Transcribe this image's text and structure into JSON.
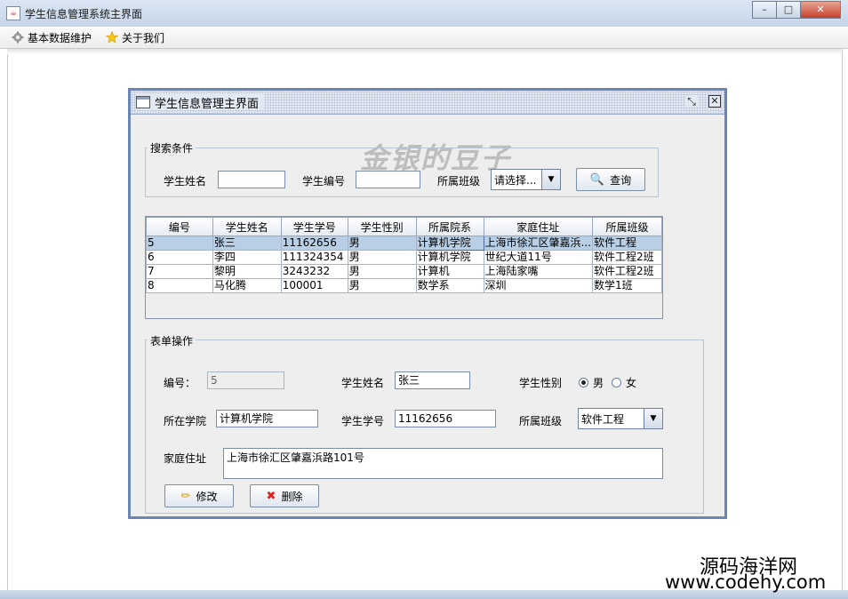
{
  "window": {
    "title": "学生信息管理系统主界面",
    "min": "–",
    "max": "□",
    "close": "✕"
  },
  "menu": [
    {
      "label": "基本数据维护",
      "icon": "gear-icon"
    },
    {
      "label": "关于我们",
      "icon": "star-icon"
    }
  ],
  "internal_frame": {
    "title": "学生信息管理主界面"
  },
  "watermark": "金银的豆子",
  "search": {
    "legend": "搜索条件",
    "name_label": "学生姓名",
    "name_value": "",
    "id_label": "学生编号",
    "id_value": "",
    "class_label": "所属班级",
    "class_value": "请选择...",
    "query_button": "查询"
  },
  "table": {
    "columns": [
      "编号",
      "学生姓名",
      "学生学号",
      "学生性别",
      "所属院系",
      "家庭住址",
      "所属班级"
    ],
    "rows": [
      [
        "5",
        "张三",
        "11162656",
        "男",
        "计算机学院",
        "上海市徐汇区肇嘉浜...",
        "软件工程"
      ],
      [
        "6",
        "李四",
        "111324354",
        "男",
        "计算机学院",
        "世纪大道11号",
        "软件工程2班"
      ],
      [
        "7",
        "黎明",
        "3243232",
        "男",
        "计算机",
        "上海陆家嘴",
        "软件工程2班"
      ],
      [
        "8",
        "马化腾",
        "100001",
        "男",
        "数学系",
        "深圳",
        "数学1班"
      ]
    ],
    "selected_row": 0
  },
  "form": {
    "legend": "表单操作",
    "id_label": "编号：",
    "id_value": "5",
    "name_label": "学生姓名",
    "name_value": "张三",
    "gender_label": "学生性别",
    "gender_male": "男",
    "gender_female": "女",
    "college_label": "所在学院",
    "college_value": "计算机学院",
    "stuno_label": "学生学号",
    "stuno_value": "11162656",
    "class_label": "所属班级",
    "class_value": "软件工程",
    "address_label": "家庭住址",
    "address_value": "上海市徐汇区肇嘉浜路101号",
    "edit_button": "修改",
    "delete_button": "删除"
  },
  "branding": {
    "line1": "源码海洋网",
    "line2": "www.codehy.com"
  }
}
